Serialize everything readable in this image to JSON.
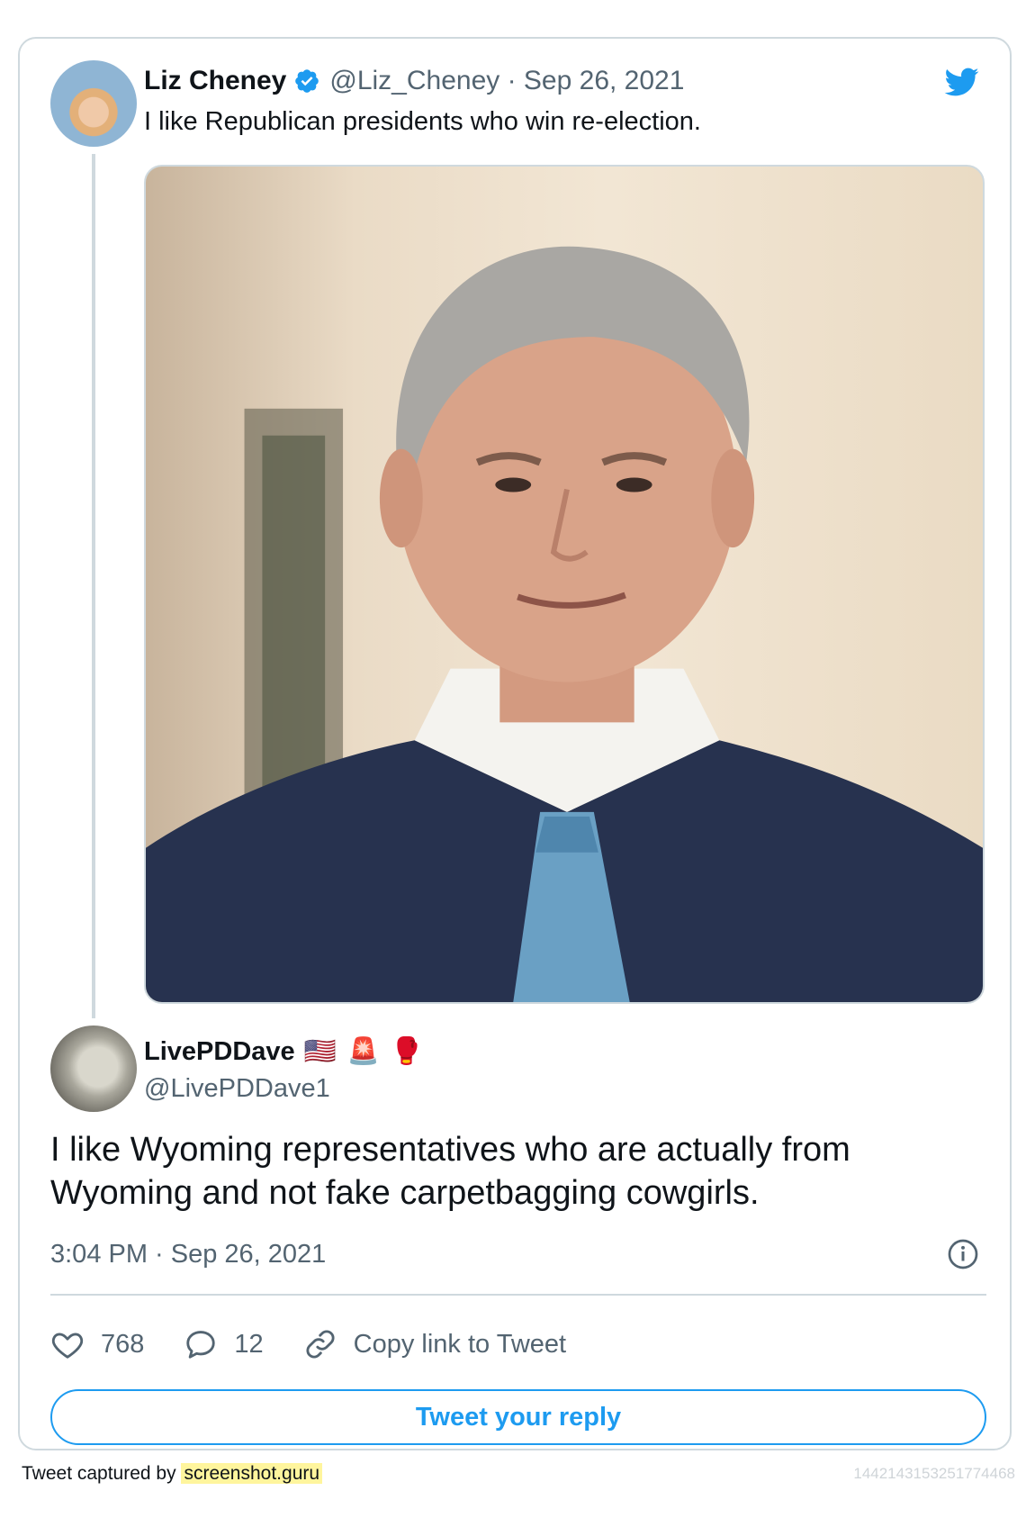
{
  "quoted_tweet": {
    "author_name": "Liz Cheney",
    "handle_date": "@Liz_Cheney · Sep 26, 2021",
    "text": "I like Republican presidents who win re-election.",
    "verified_icon": "verified-badge-icon",
    "media_alt": "portrait-photo"
  },
  "reply_tweet": {
    "author_name": "LivePDDave",
    "name_emojis": [
      "🇺🇸",
      "🚨",
      "🥊"
    ],
    "handle": "@LivePDDave1",
    "text": "I like Wyoming representatives who are actually from Wyoming and not fake carpetbagging cowgirls.",
    "timestamp": "3:04 PM · Sep 26, 2021"
  },
  "actions": {
    "likes": "768",
    "replies": "12",
    "copy_link": "Copy link to Tweet"
  },
  "reply_button": "Tweet your reply",
  "footer": {
    "prefix": "Tweet captured by",
    "site": "screenshot.guru",
    "tweet_id": "1442143153251774468"
  },
  "colors": {
    "accent": "#1d9bf0",
    "border": "#cfd9de",
    "muted": "#536471",
    "highlight": "#fff59d"
  }
}
